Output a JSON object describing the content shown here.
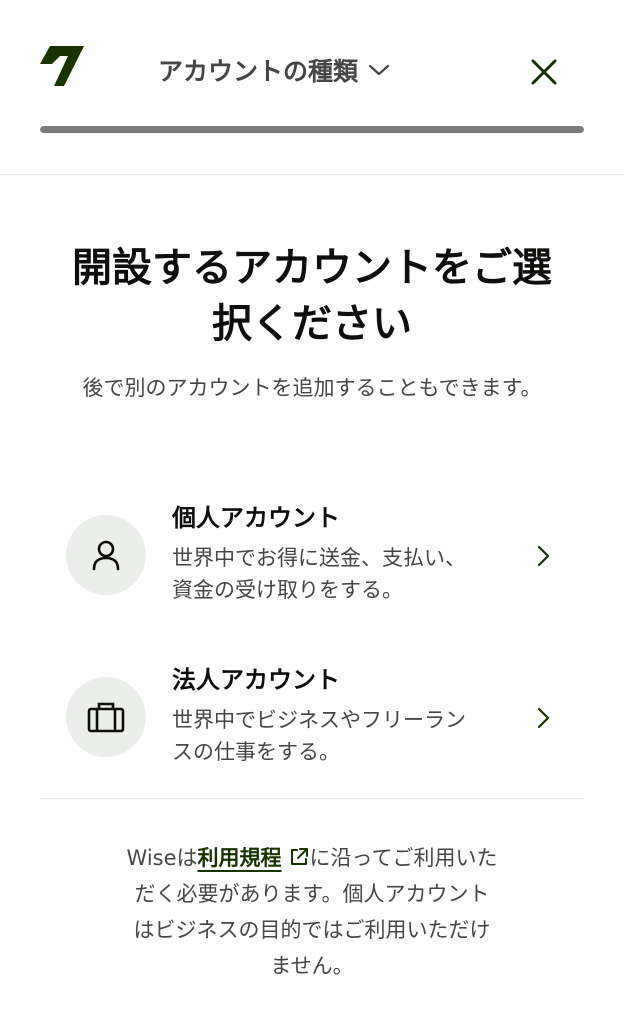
{
  "header": {
    "step_title": "アカウントの種類",
    "progress_percent": 100,
    "colors": {
      "brand": "#163300",
      "progress": "#7b7b7b"
    }
  },
  "main": {
    "heading_line1": "開設するアカウントをご選",
    "heading_line2": "択ください",
    "subheading": "後で別のアカウントを追加することもできます。"
  },
  "options": [
    {
      "title": "個人アカウント",
      "desc_line1": "世界中でお得に送金、支払い、",
      "desc_line2": "資金の受け取りをする。",
      "icon": "person-icon"
    },
    {
      "title": "法人アカウント",
      "desc_line1": "世界中でビジネスやフリーラン",
      "desc_line2": "スの仕事をする。",
      "icon": "briefcase-icon"
    }
  ],
  "footer": {
    "prefix": "Wiseは",
    "link_label": "利用規程",
    "after_link": "に沿ってご利用いた",
    "line2": "だく必要があります。個人アカウント",
    "line3": "はビジネスの目的ではご利用いただけ",
    "line4": "ません。"
  }
}
